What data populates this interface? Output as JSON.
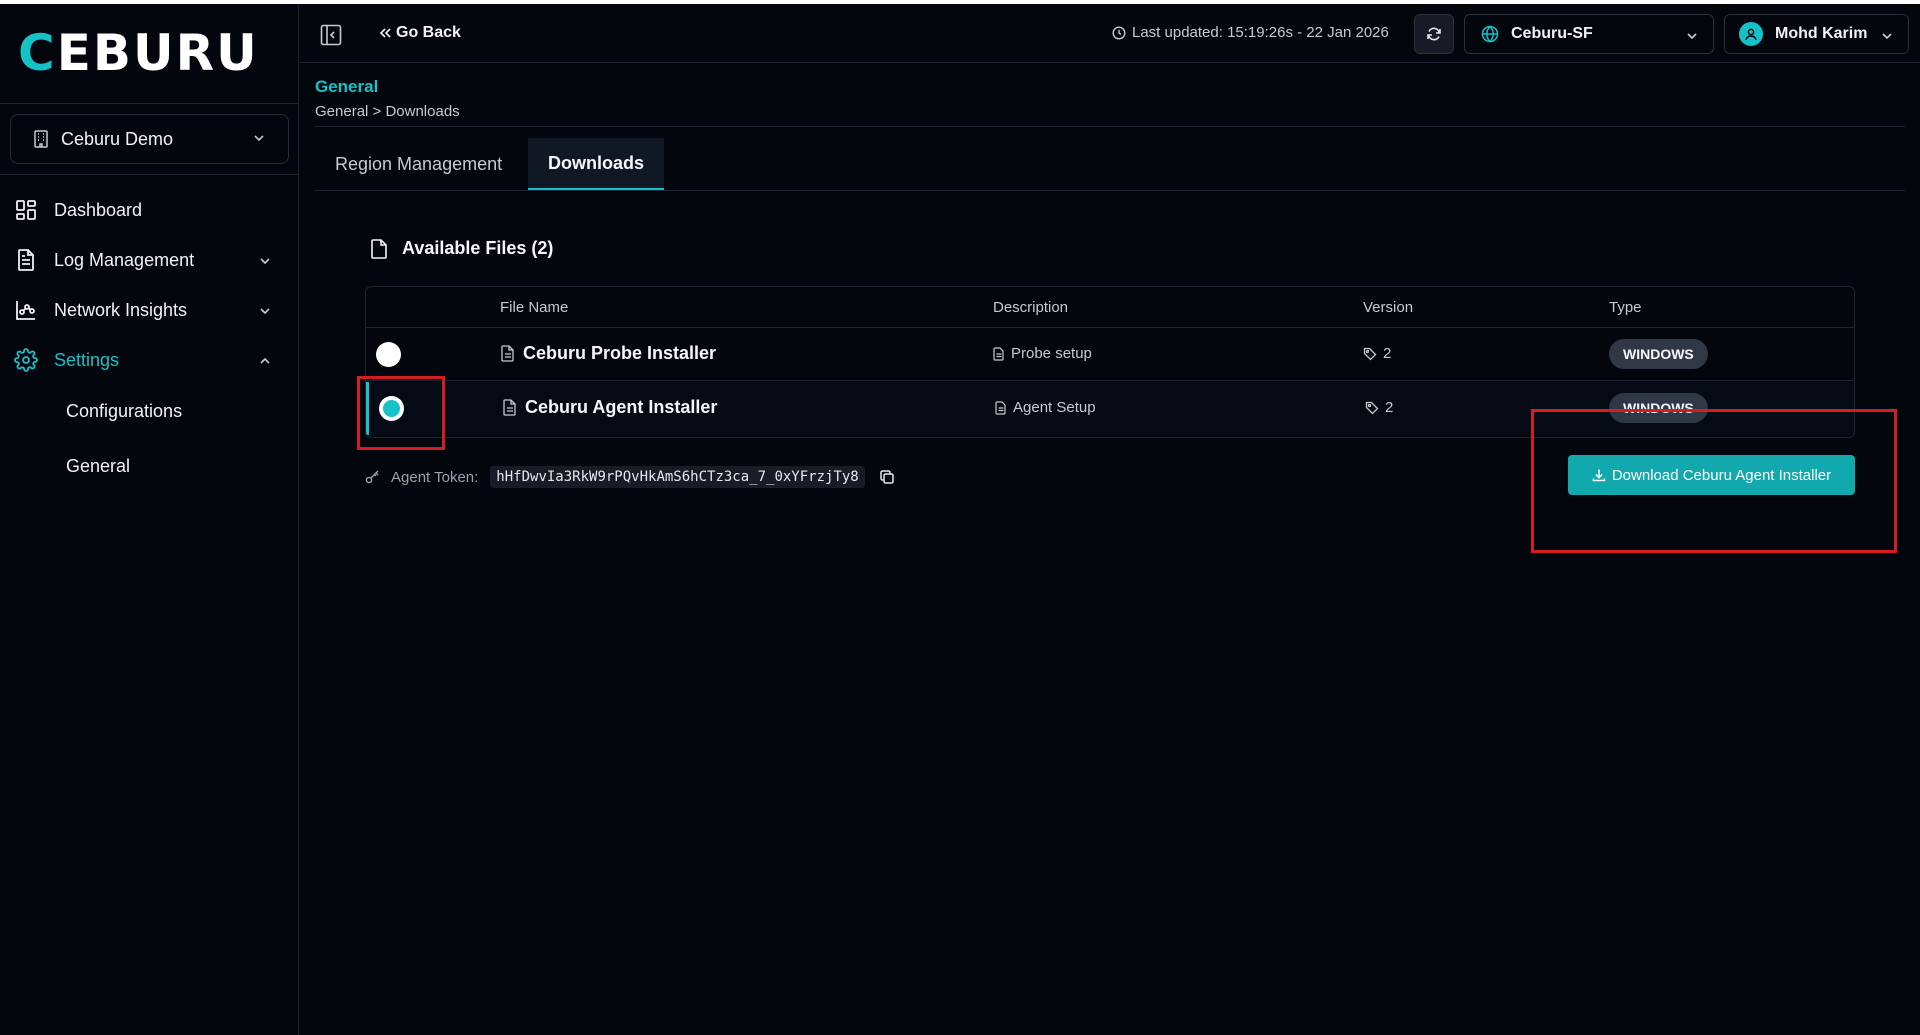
{
  "brand": {
    "logo_text_lead": "C",
    "logo_text_rest": "EBURU"
  },
  "sidebar": {
    "org": {
      "label": "Ceburu Demo"
    },
    "items": [
      {
        "label": "Dashboard"
      },
      {
        "label": "Log Management"
      },
      {
        "label": "Network Insights"
      },
      {
        "label": "Settings"
      }
    ],
    "sub_items": [
      {
        "label": "Configurations"
      },
      {
        "label": "General"
      }
    ]
  },
  "topbar": {
    "go_back": "Go Back",
    "last_updated": "Last updated: 15:19:26s - 22 Jan 2026",
    "region": "Ceburu-SF",
    "user": "Mohd Karim"
  },
  "header": {
    "title": "General",
    "breadcrumb": "General > Downloads"
  },
  "tabs": [
    {
      "label": "Region Management"
    },
    {
      "label": "Downloads"
    }
  ],
  "files": {
    "heading": "Available Files (2)",
    "columns": [
      "File Name",
      "Description",
      "Version",
      "Type"
    ],
    "rows": [
      {
        "name": "Ceburu Probe Installer",
        "description": "Probe setup",
        "version": "2",
        "type": "WINDOWS"
      },
      {
        "name": "Ceburu Agent Installer",
        "description": "Agent Setup",
        "version": "2",
        "type": "WINDOWS"
      }
    ]
  },
  "token": {
    "label": "Agent Token:",
    "value": "hHfDwvIa3RkW9rPQvHkAmS6hCTz3ca_7_0xYFrzjTy8"
  },
  "download_button": "Download Ceburu Agent Installer",
  "colors": {
    "accent": "#14c2c8",
    "background": "#03060d",
    "annotation": "#d31d23"
  }
}
